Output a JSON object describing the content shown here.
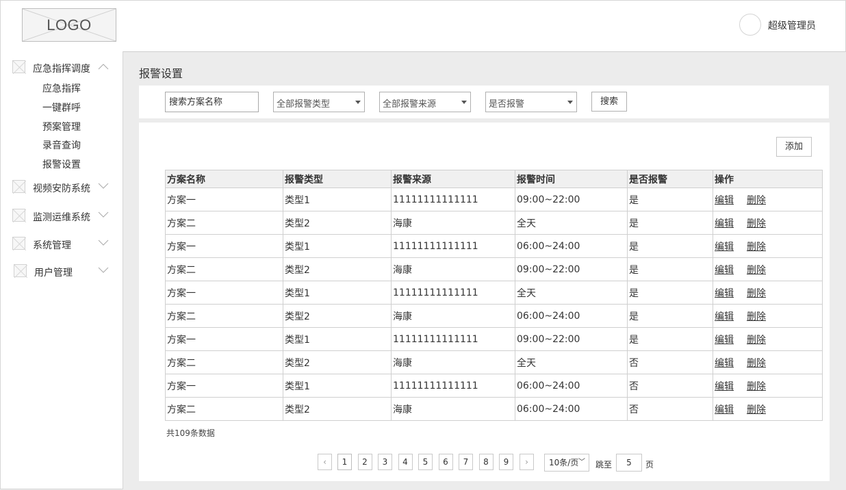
{
  "header": {
    "logo_text": "LOGO",
    "user_name": "超级管理员"
  },
  "sidebar": {
    "groups": [
      {
        "label": "应急指挥调度",
        "icon": "placeholder-image-icon",
        "expanded": true,
        "items": [
          "应急指挥",
          "一键群呼",
          "预案管理",
          "录音查询",
          "报警设置"
        ]
      },
      {
        "label": "视频安防系统",
        "icon": "placeholder-image-icon",
        "expanded": false
      },
      {
        "label": "监测运维系统",
        "icon": "placeholder-image-icon",
        "expanded": false
      },
      {
        "label": "系统管理",
        "icon": "placeholder-image-icon",
        "expanded": false
      },
      {
        "label": "用户管理",
        "icon": "placeholder-image-icon",
        "expanded": false
      }
    ]
  },
  "page": {
    "title": "报警设置"
  },
  "search": {
    "placeholder": "搜索方案名称",
    "type_select": "全部报警类型",
    "source_select": "全部报警来源",
    "alarm_select": "是否报警",
    "button": "搜索"
  },
  "toolbar": {
    "add_label": "添加"
  },
  "table": {
    "columns": [
      "方案名称",
      "报警类型",
      "报警来源",
      "报警时间",
      "是否报警",
      "操作"
    ],
    "edit_label": "编辑",
    "delete_label": "删除",
    "rows": [
      [
        "方案一",
        "类型1",
        "11111111111111",
        "09:00~22:00",
        "是"
      ],
      [
        "方案二",
        "类型2",
        "海康",
        "全天",
        "是"
      ],
      [
        "方案一",
        "类型1",
        "11111111111111",
        "06:00~24:00",
        "是"
      ],
      [
        "方案二",
        "类型2",
        "海康",
        "09:00~22:00",
        "是"
      ],
      [
        "方案一",
        "类型1",
        "11111111111111",
        "全天",
        "是"
      ],
      [
        "方案二",
        "类型2",
        "海康",
        "06:00~24:00",
        "是"
      ],
      [
        "方案一",
        "类型1",
        "11111111111111",
        "09:00~22:00",
        "是"
      ],
      [
        "方案二",
        "类型2",
        "海康",
        "全天",
        "否"
      ],
      [
        "方案一",
        "类型1",
        "11111111111111",
        "06:00~24:00",
        "否"
      ],
      [
        "方案二",
        "类型2",
        "海康",
        "06:00~24:00",
        "否"
      ]
    ],
    "total_text": "共109条数据"
  },
  "pagination": {
    "prev": "‹",
    "next": "›",
    "pages": [
      "1",
      "2",
      "3",
      "4",
      "5",
      "6",
      "7",
      "8",
      "9"
    ],
    "current": "1",
    "page_size": "10条/页",
    "jump_label": "跳至",
    "jump_value": "5",
    "page_suffix": "页"
  }
}
